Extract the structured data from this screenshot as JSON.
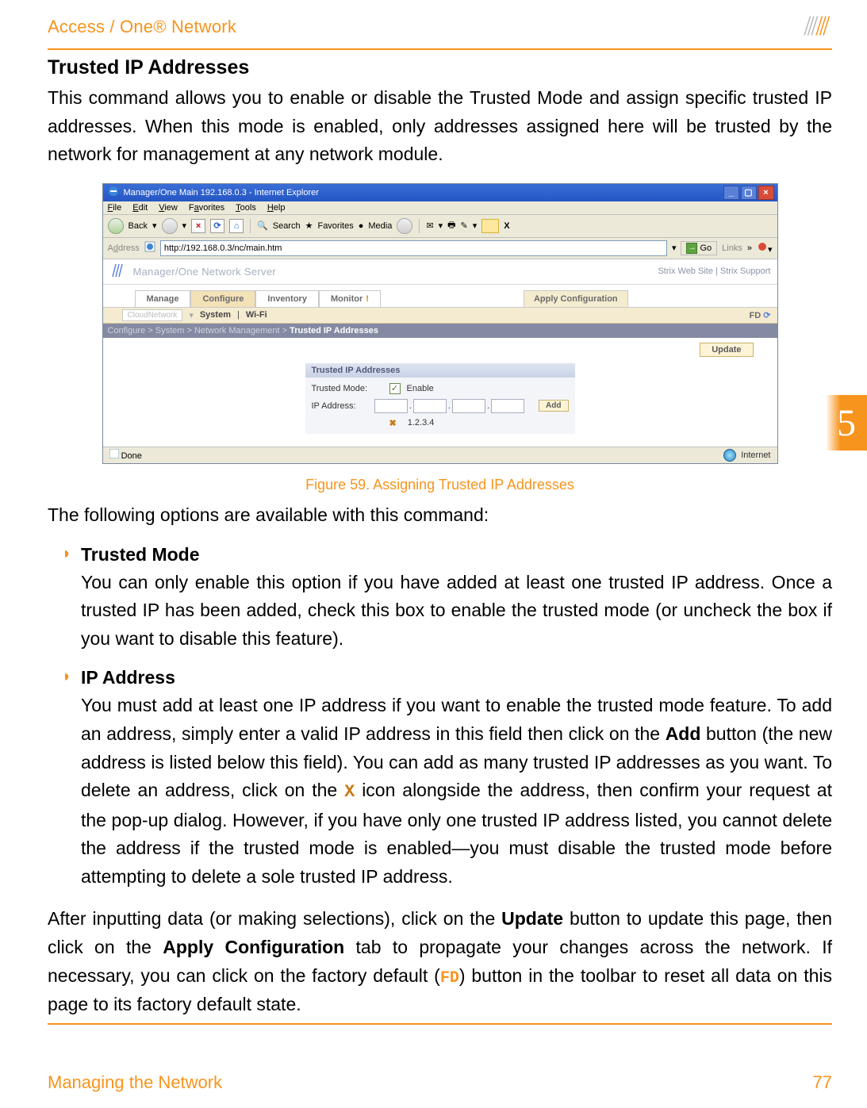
{
  "brand": "Access / One® Network",
  "section": {
    "heading": "Trusted IP Addresses",
    "intro": "This command allows you to enable or disable the Trusted Mode and assign specific trusted IP addresses. When this mode is enabled, only addresses assigned here will be trusted by the network for management at any network module."
  },
  "figure": {
    "caption": "Figure 59. Assigning Trusted IP Addresses"
  },
  "screenshot": {
    "title": "Manager/One Main 192.168.0.3 - Internet Explorer",
    "menu": {
      "file": "File",
      "edit": "Edit",
      "view": "View",
      "favorites": "Favorites",
      "tools": "Tools",
      "help": "Help"
    },
    "toolbar": {
      "back": "Back",
      "search": "Search",
      "favorites": "Favorites",
      "media": "Media"
    },
    "address_label": "Address",
    "address_value": "http://192.168.0.3/nc/main.htm",
    "go": "Go",
    "links": "Links",
    "strix_title": "Manager/One Network Server",
    "strix_links": "Strix Web Site  |  Strix Support",
    "tabs": {
      "manage": "Manage",
      "configure": "Configure",
      "inventory": "Inventory",
      "monitor": "Monitor",
      "apply": "Apply Configuration"
    },
    "subbar": {
      "cloud": "CloudNetwork",
      "system": "System",
      "wifi": "Wi-Fi",
      "fd": "FD"
    },
    "breadcrumb_prefix": "Configure > System > Network Management > ",
    "breadcrumb_current": "Trusted IP Addresses",
    "update": "Update",
    "panel": {
      "header": "Trusted IP Addresses",
      "mode_label": "Trusted Mode:",
      "enable": "Enable",
      "ip_label": "IP Address:",
      "add": "Add",
      "entry": "1.2.3.4"
    },
    "status_done": "Done",
    "status_zone": "Internet"
  },
  "options_intro": "The following options are available with this command:",
  "opts": {
    "mode": {
      "title": "Trusted Mode",
      "body": "You can only enable this option if you have added at least one trusted IP address. Once a trusted IP has been added, check this box to enable the trusted mode (or uncheck the box if you want to disable this feature)."
    },
    "ip": {
      "title": "IP Address",
      "body1": "You must add at least one IP address if you want to enable the trusted mode feature. To add an address, simply enter a valid IP address in this field then click on the ",
      "add_word": "Add",
      "body2": " button (the new address is listed below this field). You can add as many trusted IP addresses as you want. To delete an address, click on the ",
      "x_icon": "X",
      "body3": " icon alongside the address, then confirm your request at the pop-up dialog. However, if you have only one trusted IP address listed, you cannot delete the address if the trusted mode is enabled—you must disable the trusted mode before attempting to delete a sole trusted IP address."
    }
  },
  "closing": {
    "p1a": "After inputting data (or making selections), click on the ",
    "update_word": "Update",
    "p1b": " button to update this page, then click on the ",
    "apply_word": "Apply Configuration",
    "p1c": " tab to propagate your changes across the network. If necessary, you can click on the factory default (",
    "fd": "FD",
    "p1d": ") button in the toolbar to reset all data on this page to its factory default state."
  },
  "chapter": "5",
  "footer": {
    "left": "Managing the Network",
    "page": "77"
  }
}
